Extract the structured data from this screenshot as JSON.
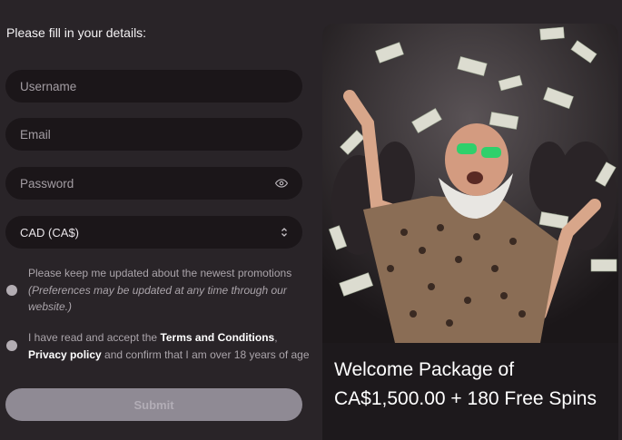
{
  "form": {
    "heading": "Please fill in your details:",
    "username_placeholder": "Username",
    "email_placeholder": "Email",
    "password_placeholder": "Password",
    "currency_value": "CAD (CA$)",
    "promo_text_1": "Please keep me updated about the newest promotions",
    "promo_text_2": "(Preferences may be updated at any time through our website.)",
    "terms_pre": "I have read and accept the ",
    "terms_link": "Terms and Conditions",
    "terms_comma": ",",
    "privacy_link": "Privacy policy",
    "terms_post": " and confirm that I am over 18 years of age",
    "submit_label": "Submit"
  },
  "promo": {
    "text": "Welcome Package of CA$1,500.00 + 180 Free Spins"
  },
  "colors": {
    "background": "#292428",
    "field": "#1b1619",
    "submit": "#8f8a94"
  },
  "icons": {
    "password_toggle": "eye-icon",
    "currency_select": "chevron-updown-icon"
  }
}
